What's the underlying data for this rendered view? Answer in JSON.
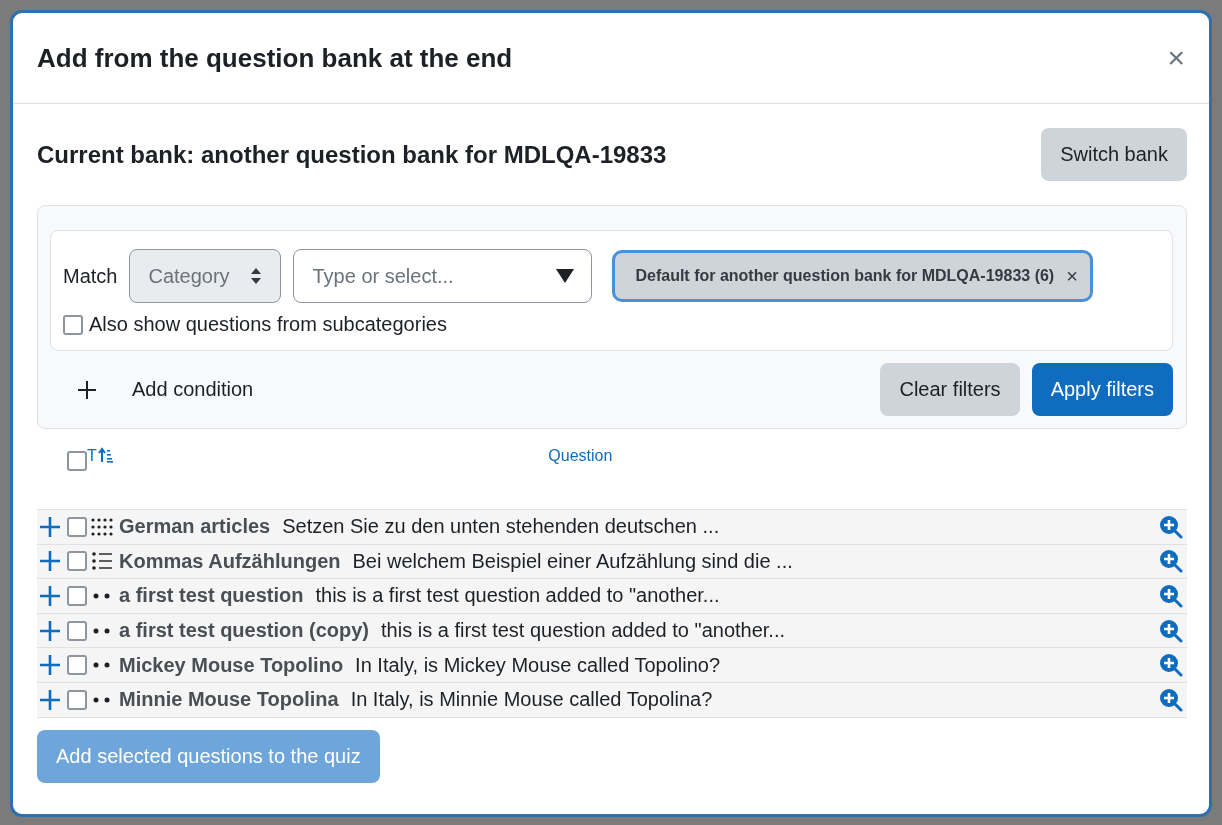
{
  "dialog": {
    "title": "Add from the question bank at the end",
    "close": "×"
  },
  "bank": {
    "heading": "Current bank: another question bank for MDLQA-19833",
    "switch_button": "Switch bank"
  },
  "filter": {
    "match_label": "Match",
    "category_select": {
      "value": "Category",
      "disabled": true
    },
    "search": {
      "placeholder": "Type or select..."
    },
    "chips": [
      {
        "label": "Default for another question bank for MDLQA-19833 (6)",
        "remove": "×"
      }
    ],
    "subcategories": {
      "label": "Also show questions from subcategories",
      "checked": false
    },
    "add_condition": "Add condition",
    "clear_button": "Clear filters",
    "apply_button": "Apply filters"
  },
  "table": {
    "select_all": {
      "checked": false
    },
    "sort_label": "T",
    "column": "Question",
    "rows": [
      {
        "kind": "grid",
        "name": "German articles",
        "text": "Setzen Sie zu den unten stehenden deutschen ...",
        "checked": false
      },
      {
        "kind": "list",
        "name": "Kommas Aufzählungen",
        "text": "Bei welchem Beispiel einer Aufzählung sind die ...",
        "checked": false
      },
      {
        "kind": "dots",
        "name": "a first test question",
        "text": "this is a first test question added to \"another...",
        "checked": false
      },
      {
        "kind": "dots",
        "name": "a first test question (copy)",
        "text": "this is a first test question added to \"another...",
        "checked": false
      },
      {
        "kind": "dots",
        "name": "Mickey Mouse Topolino",
        "text": "In Italy, is Mickey Mouse called Topolino?",
        "checked": false
      },
      {
        "kind": "dots",
        "name": "Minnie Mouse Topolina",
        "text": "In Italy, is Minnie Mouse called Topolina?",
        "checked": false
      }
    ]
  },
  "footer": {
    "add_button": "Add selected questions to the quiz",
    "disabled": true
  }
}
